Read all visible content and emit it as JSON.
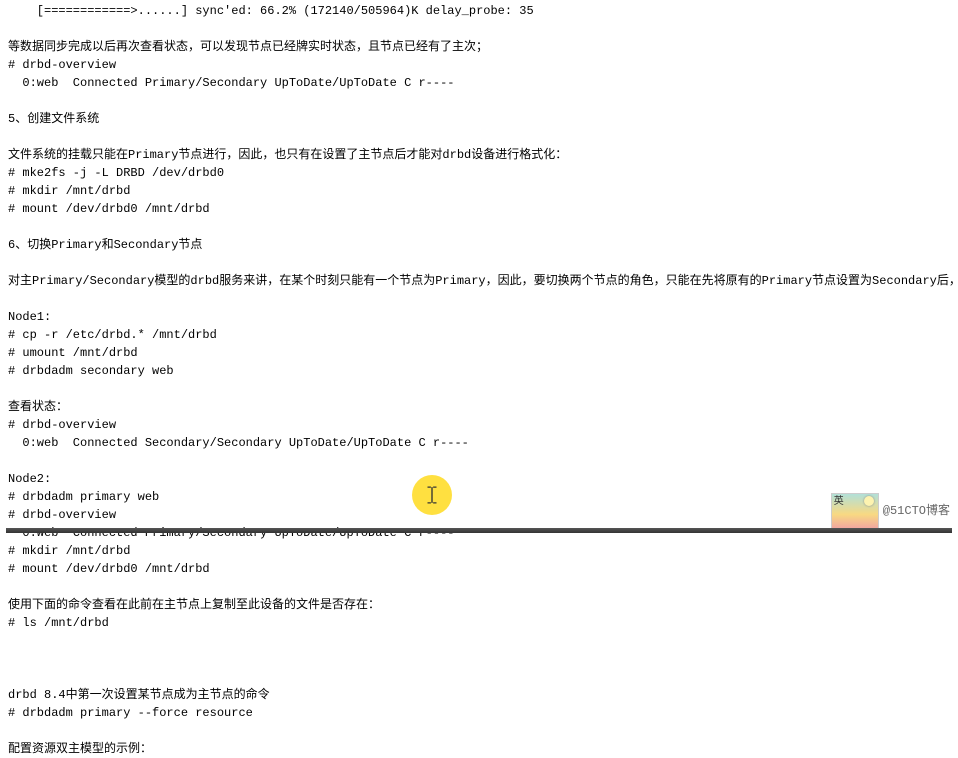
{
  "lines": [
    "    [============>......] sync'ed: 66.2% (172140/505964)K delay_probe: 35",
    "",
    "等数据同步完成以后再次查看状态，可以发现节点已经牌实时状态，且节点已经有了主次；",
    "# drbd-overview",
    "  0:web  Connected Primary/Secondary UpToDate/UpToDate C r----",
    "",
    "5、创建文件系统",
    "",
    "文件系统的挂载只能在Primary节点进行，因此，也只有在设置了主节点后才能对drbd设备进行格式化：",
    "# mke2fs -j -L DRBD /dev/drbd0",
    "# mkdir /mnt/drbd",
    "# mount /dev/drbd0 /mnt/drbd",
    "",
    "6、切换Primary和Secondary节点",
    "",
    "对主Primary/Secondary模型的drbd服务来讲，在某个时刻只能有一个节点为Primary，因此，要切换两个节点的角色，只能在先将原有的Primary节点设置为Secondary后，才能原来的Secondary节点设置为Primary:",
    "",
    "Node1:",
    "# cp -r /etc/drbd.* /mnt/drbd",
    "# umount /mnt/drbd",
    "# drbdadm secondary web",
    "",
    "查看状态：",
    "# drbd-overview",
    "  0:web  Connected Secondary/Secondary UpToDate/UpToDate C r----",
    "",
    "Node2:",
    "# drbdadm primary web",
    "# drbd-overview",
    "  0:web  Connected Primary/Secondary UpToDate/UpToDate C r----",
    "# mkdir /mnt/drbd",
    "# mount /dev/drbd0 /mnt/drbd",
    "",
    "使用下面的命令查看在此前在主节点上复制至此设备的文件是否存在：",
    "# ls /mnt/drbd",
    "",
    "",
    "",
    "drbd 8.4中第一次设置某节点成为主节点的命令",
    "# drbdadm primary --force resource",
    "",
    "配置资源双主模型的示例："
  ],
  "watermark": {
    "text": "@51CTO博客"
  }
}
